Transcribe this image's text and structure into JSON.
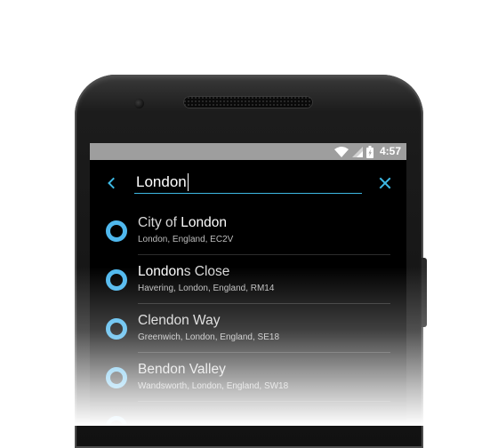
{
  "status_bar": {
    "time": "4:57",
    "icons": [
      "wifi-icon",
      "cellular-icon",
      "battery-icon"
    ]
  },
  "search": {
    "query": "London",
    "back_icon": "chevron-left-icon",
    "clear_icon": "close-icon",
    "accent_color": "#3db8e3"
  },
  "results": [
    {
      "title_parts": [
        {
          "text": "City of ",
          "highlight": false
        },
        {
          "text": "London",
          "highlight": true
        }
      ],
      "subtitle": "London, England, EC2V"
    },
    {
      "title_parts": [
        {
          "text": "London",
          "highlight": true
        },
        {
          "text": "s Close",
          "highlight": false
        }
      ],
      "subtitle": "Havering, London, England, RM14"
    },
    {
      "title_parts": [
        {
          "text": "Clendon Way",
          "highlight": false
        }
      ],
      "subtitle": "Greenwich, London, England, SE18"
    },
    {
      "title_parts": [
        {
          "text": "Bendon Valley",
          "highlight": false
        }
      ],
      "subtitle": "Wandsworth, London, England, SW18"
    },
    {
      "title_parts": [
        {
          "text": "",
          "highlight": false
        }
      ],
      "subtitle": ""
    }
  ],
  "pin_color": "#4fb8ee"
}
